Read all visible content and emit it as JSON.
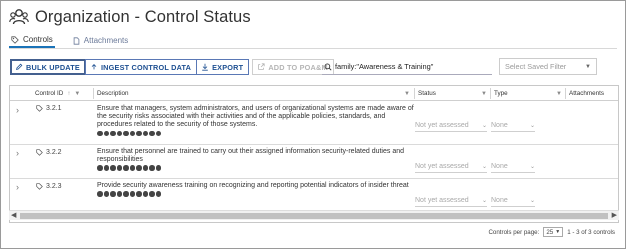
{
  "header": {
    "title": "Organization - Control Status",
    "icon": "users-icon"
  },
  "tabs": [
    {
      "label": "Controls",
      "active": true
    },
    {
      "label": "Attachments",
      "active": false
    }
  ],
  "toolbar": {
    "bulk_update": "BULK UPDATE",
    "ingest": "INGEST CONTROL DATA",
    "export": "EXPORT",
    "add_poam": "ADD TO POA&M"
  },
  "search": {
    "value": "family:\"Awareness & Training\""
  },
  "saved_filter": {
    "placeholder": "Select Saved Filter"
  },
  "table": {
    "columns": {
      "control_id": "Control ID",
      "description": "Description",
      "status": "Status",
      "type": "Type",
      "attachments": "Attachments"
    },
    "rows": [
      {
        "control_id": "3.2.1",
        "description": "Ensure that managers, system administrators, and users of organizational systems are made aware of the security risks associated with their activities and of the applicable policies, standards, and procedures related to the security of those systems.",
        "status": "Not yet assessed",
        "type": "None"
      },
      {
        "control_id": "3.2.2",
        "description": "Ensure that personnel are trained to carry out their assigned information security-related duties and responsibilities",
        "status": "Not yet assessed",
        "type": "None"
      },
      {
        "control_id": "3.2.3",
        "description": "Provide security awareness training on recognizing and reporting potential indicators of insider threat",
        "status": "Not yet assessed",
        "type": "None"
      }
    ]
  },
  "footer": {
    "per_page_label": "Controls per page:",
    "per_page_value": "25",
    "range": "1 - 3 of 3 controls"
  },
  "colors": {
    "accent": "#1d4f91",
    "tab_underline": "#1a73b8"
  }
}
